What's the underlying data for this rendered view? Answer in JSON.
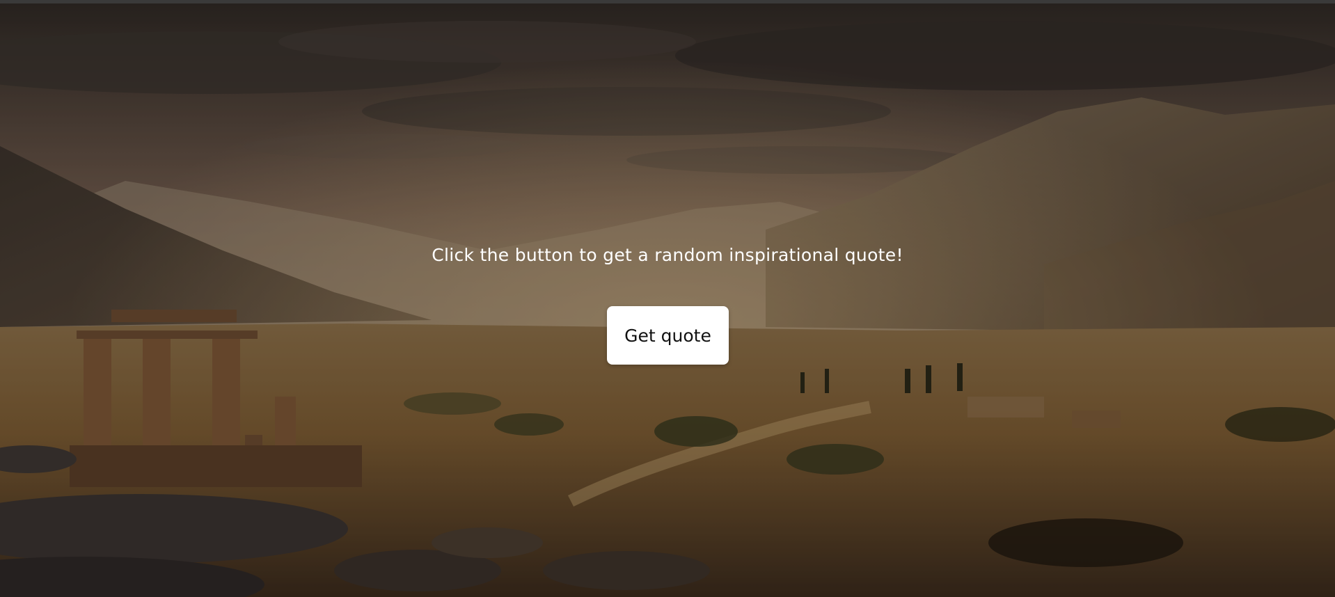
{
  "main": {
    "prompt": "Click the button to get a random inspirational quote!",
    "button_label": "Get quote"
  }
}
